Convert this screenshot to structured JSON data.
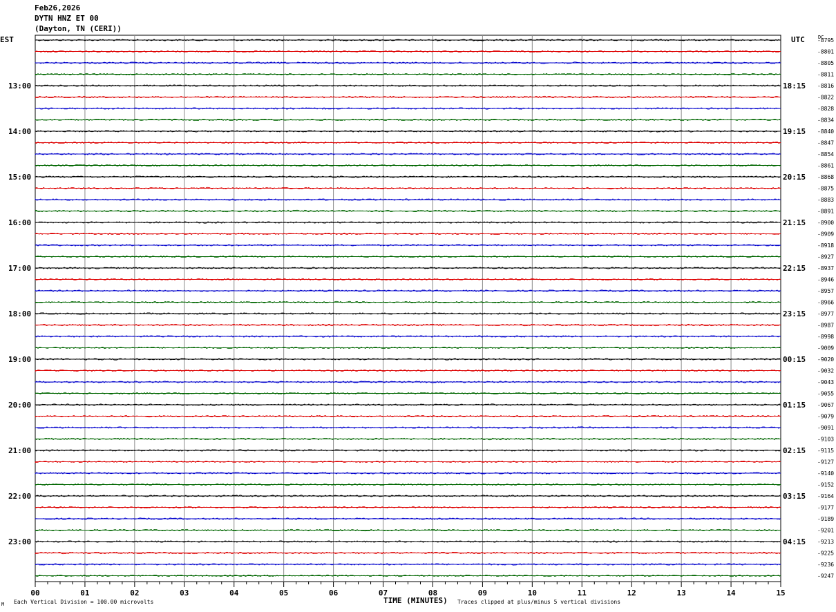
{
  "header": {
    "date": "Feb26,2026",
    "station": "DYTN HNZ ET 00",
    "location": "(Dayton, TN (CERI))"
  },
  "chart_data": {
    "type": "line",
    "subtype": "helicorder",
    "left_axis_title": "EST",
    "right_axis_title": "UTC",
    "dc_label": "DC",
    "xlabel": "TIME (MINUTES)",
    "xlim": [
      0,
      15
    ],
    "x_ticks": [
      "00",
      "01",
      "02",
      "03",
      "04",
      "05",
      "06",
      "07",
      "08",
      "09",
      "10",
      "11",
      "12",
      "13",
      "14",
      "15"
    ],
    "left_hour_labels": [
      "13:00",
      "14:00",
      "15:00",
      "16:00",
      "17:00",
      "18:00",
      "19:00",
      "20:00",
      "21:00",
      "22:00",
      "23:00"
    ],
    "right_hour_labels": [
      "18:15",
      "19:15",
      "20:15",
      "21:15",
      "22:15",
      "23:15",
      "00:15",
      "01:15",
      "02:15",
      "03:15",
      "04:15"
    ],
    "trace_colors": [
      "#000000",
      "#dd0000",
      "#0000cc",
      "#006600"
    ],
    "traces_per_hour": 4,
    "trace_count": 48,
    "dc_offsets": [
      "-8795",
      "-8801",
      "-8805",
      "-8811",
      "-8816",
      "-8822",
      "-8828",
      "-8834",
      "-8840",
      "-8847",
      "-8854",
      "-8861",
      "-8868",
      "-8875",
      "-8883",
      "-8891",
      "-8900",
      "-8909",
      "-8918",
      "-8927",
      "-8937",
      "-8946",
      "-8957",
      "-8966",
      "-8977",
      "-8987",
      "-8998",
      "-9009",
      "-9020",
      "-9032",
      "-9043",
      "-9055",
      "-9067",
      "-9079",
      "-9091",
      "-9103",
      "-9115",
      "-9127",
      "-9140",
      "-9152",
      "-9164",
      "-9177",
      "-9189",
      "-9201",
      "-9213",
      "-9225",
      "-9236",
      "-9247"
    ],
    "grid": true,
    "scale_note": "Each Vertical Division =  100.00 microvolts",
    "clip_note": "Traces clipped at plus/minus 5 vertical divisions",
    "corner_mark": "M"
  }
}
